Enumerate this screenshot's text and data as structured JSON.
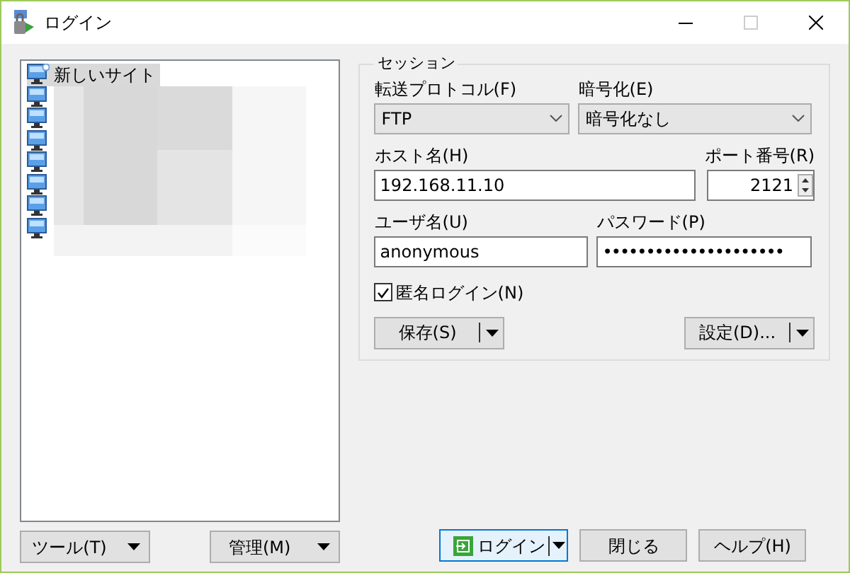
{
  "window": {
    "title": "ログイン"
  },
  "sites": [
    {
      "kind": "new",
      "label": "新しいサイト",
      "selected": true
    },
    {
      "kind": "site",
      "selected": false
    },
    {
      "kind": "site",
      "selected": false
    },
    {
      "kind": "site",
      "selected": false
    },
    {
      "kind": "site",
      "selected": false
    },
    {
      "kind": "site",
      "selected": false
    },
    {
      "kind": "site",
      "selected": false
    },
    {
      "kind": "site",
      "selected": false
    }
  ],
  "session": {
    "title": "セッション",
    "protocol": {
      "label": "転送プロトコル(F)",
      "value": "FTP"
    },
    "encryption": {
      "label": "暗号化(E)",
      "value": "暗号化なし"
    },
    "host": {
      "label": "ホスト名(H)",
      "value": "192.168.11.10"
    },
    "port": {
      "label": "ポート番号(R)",
      "value": "2121"
    },
    "user": {
      "label": "ユーザ名(U)",
      "value": "anonymous"
    },
    "password": {
      "label": "パスワード(P)",
      "value": "•••••••••••••••••••••"
    },
    "anonymous": {
      "label": "匿名ログイン(N)",
      "checked": true
    },
    "save_button": "保存(S)",
    "advanced_button": "設定(D)..."
  },
  "bottom": {
    "tools": "ツール(T)",
    "manage": "管理(M)",
    "login": "ログイン",
    "close": "閉じる",
    "help": "ヘルプ(H)"
  }
}
